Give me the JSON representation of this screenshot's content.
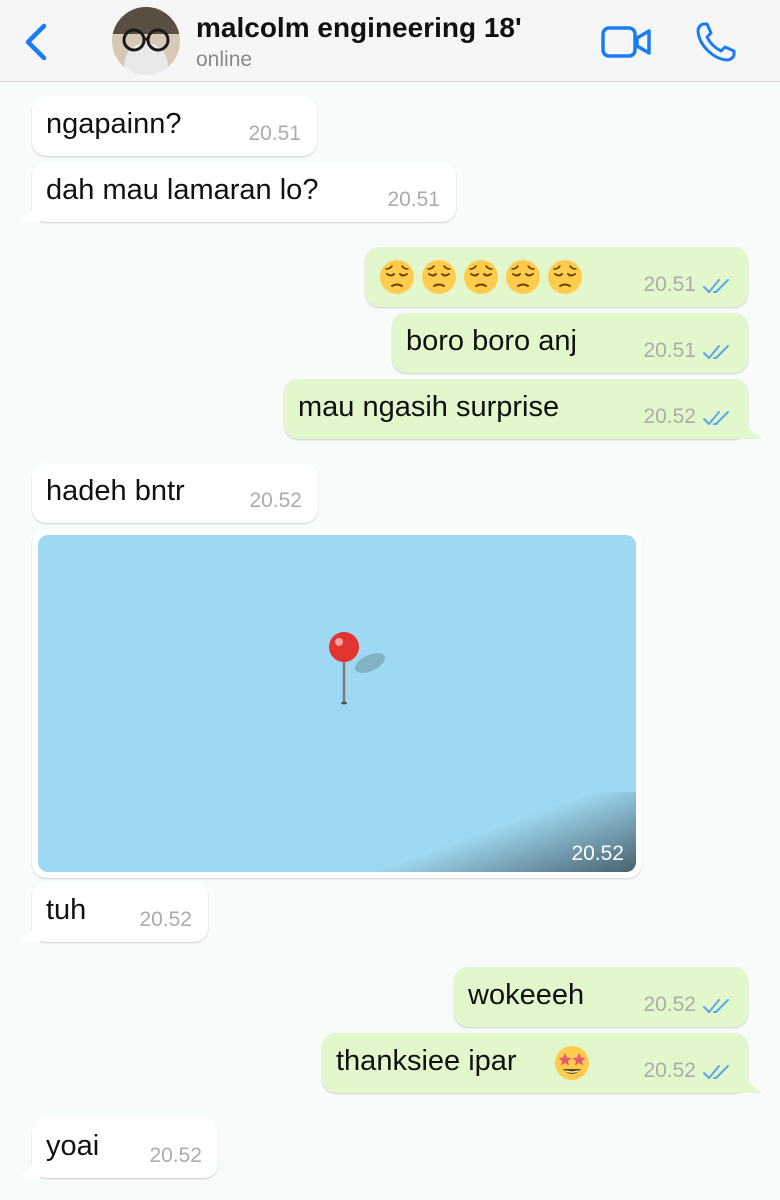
{
  "header": {
    "title": "malcolm engineering 18'",
    "status": "online"
  },
  "messages": [
    {
      "side": "in",
      "text": "ngapainn?",
      "time": "20.51"
    },
    {
      "side": "in",
      "text": "dah mau lamaran lo?",
      "time": "20.51"
    },
    {
      "side": "out",
      "emoji": [
        "pensive",
        "pensive",
        "pensive",
        "pensive",
        "pensive"
      ],
      "time": "20.51",
      "read": true
    },
    {
      "side": "out",
      "text": "boro boro anj",
      "time": "20.51",
      "read": true
    },
    {
      "side": "out",
      "text": "mau ngasih surprise",
      "time": "20.52",
      "read": true
    },
    {
      "side": "in",
      "text": "hadeh bntr",
      "time": "20.52"
    },
    {
      "side": "in",
      "type": "location",
      "time": "20.52"
    },
    {
      "side": "in",
      "text": "tuh",
      "time": "20.52"
    },
    {
      "side": "out",
      "text": "wokeeeh",
      "time": "20.52",
      "read": true
    },
    {
      "side": "out",
      "text": "thanksiee ipar",
      "emoji_after": "star-struck",
      "time": "20.52",
      "read": true
    },
    {
      "side": "in",
      "text": "yoai",
      "time": "20.52"
    }
  ],
  "colors": {
    "accent": "#1a7cf5",
    "incoming_bubble": "#ffffff",
    "outgoing_bubble": "#e2f7cb",
    "read_ticks": "#5aa7e6",
    "map_water": "#9fd8f2",
    "pin": "#e3342f"
  }
}
